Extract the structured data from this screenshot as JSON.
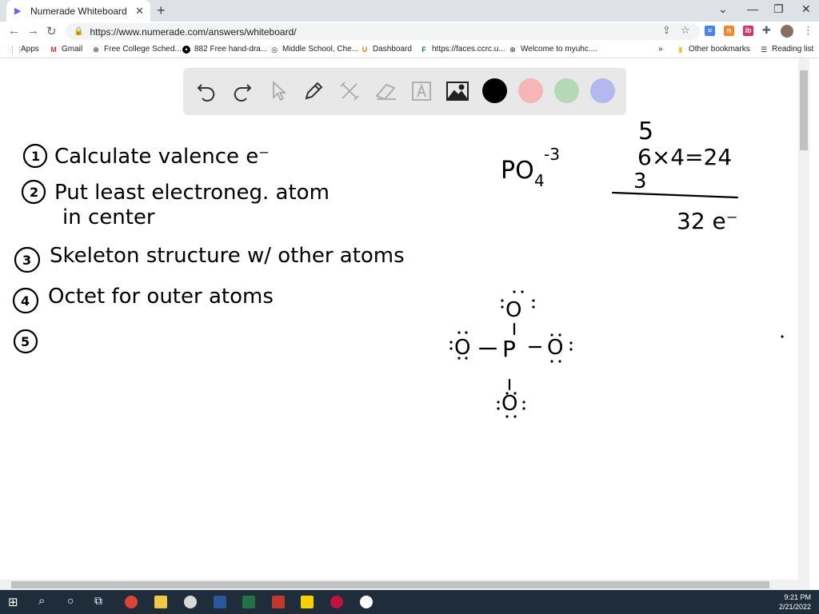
{
  "browser": {
    "tab_title": "Numerade Whiteboard",
    "tab_close": "✕",
    "new_tab": "+",
    "url": "https://www.numerade.com/answers/whiteboard/"
  },
  "bookmarks": {
    "items": [
      {
        "label": "Apps"
      },
      {
        "label": "Gmail"
      },
      {
        "label": "Free College Sched..."
      },
      {
        "label": "882 Free hand-dra..."
      },
      {
        "label": "Middle School, Che..."
      },
      {
        "label": "Dashboard"
      },
      {
        "label": "https://faces.ccrc.u..."
      },
      {
        "label": "Welcome to myuhc...."
      }
    ],
    "more": "»",
    "other": "Other bookmarks",
    "reading_list": "Reading list"
  },
  "whiteboard": {
    "tools": [
      "undo-icon",
      "redo-icon",
      "select-icon",
      "pen-icon",
      "tools-icon",
      "eraser-icon",
      "text-icon",
      "image-icon"
    ],
    "colors": [
      "#000000",
      "#f4b6b6",
      "#b4d9b4",
      "#b3b8ef"
    ],
    "notes": {
      "step1": "Calculate valence e⁻",
      "step2": "Put least electroneg. atom",
      "step2b": "in center",
      "step3": "Skeleton structure w/ other atoms",
      "step4": "Octet for outer atoms",
      "step5_num": "5"
    },
    "formula": {
      "ion": "PO",
      "sub": "4",
      "charge": "-3"
    },
    "calc": {
      "l1": "5",
      "l2": "6×4=24",
      "l3": "3",
      "total": "32 e⁻"
    },
    "lewis": {
      "central": "P",
      "top": "O",
      "left": "O",
      "right": "O",
      "bottom": "O"
    }
  },
  "taskbar": {
    "time": "9:21 PM",
    "date": "2/21/2022"
  }
}
